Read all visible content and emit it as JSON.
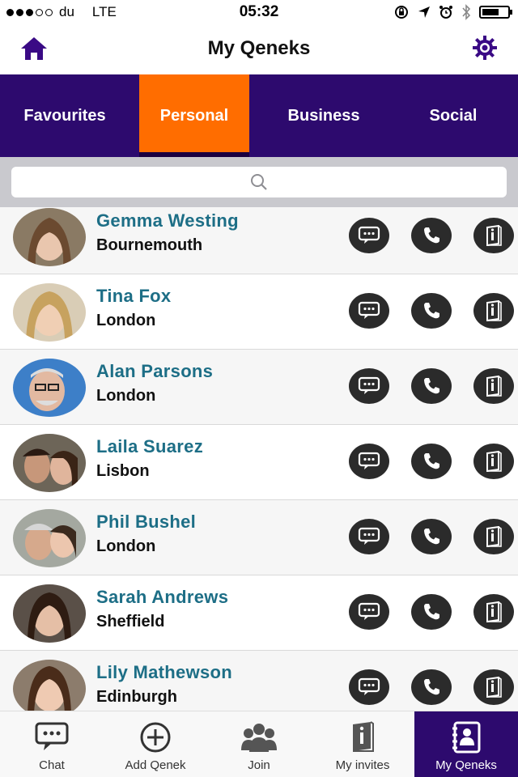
{
  "status": {
    "carrier": "du",
    "network": "LTE",
    "time": "05:32"
  },
  "header": {
    "title": "My Qeneks"
  },
  "tabs": [
    {
      "label": "Favourites"
    },
    {
      "label": "Personal",
      "active": true
    },
    {
      "label": "Business"
    },
    {
      "label": "Social"
    }
  ],
  "search": {
    "placeholder": ""
  },
  "contacts": [
    {
      "name": "Gemma Westing",
      "city": "Bournemouth"
    },
    {
      "name": "Tina Fox",
      "city": "London"
    },
    {
      "name": "Alan Parsons",
      "city": "London"
    },
    {
      "name": "Laila Suarez",
      "city": "Lisbon"
    },
    {
      "name": "Phil Bushel",
      "city": "London"
    },
    {
      "name": "Sarah Andrews",
      "city": "Sheffield"
    },
    {
      "name": "Lily Mathewson",
      "city": "Edinburgh"
    }
  ],
  "bottom_nav": [
    {
      "label": "Chat",
      "icon": "chat-icon"
    },
    {
      "label": "Add Qenek",
      "icon": "add-circle-icon"
    },
    {
      "label": "Join",
      "icon": "group-icon"
    },
    {
      "label": "My invites",
      "icon": "info-book-icon"
    },
    {
      "label": "My Qeneks",
      "icon": "contacts-book-icon",
      "active": true
    }
  ],
  "colors": {
    "purple": "#2d0a6e",
    "orange": "#ff6d00",
    "name_teal": "#1d6e86"
  }
}
